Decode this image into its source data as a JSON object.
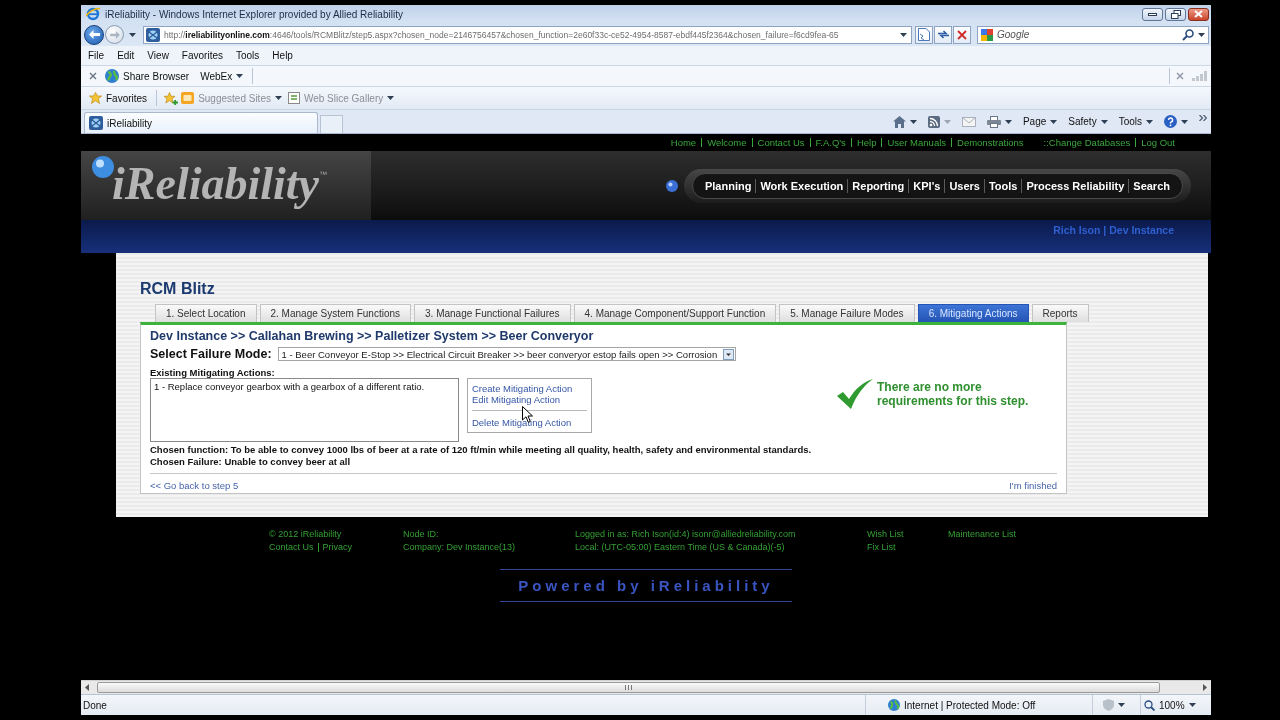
{
  "window": {
    "title": "iReliability - Windows Internet Explorer provided by Allied Reliability"
  },
  "address_bar": {
    "url": "http://**ireliabilityonline.com**:4646/tools/RCMBlitz/step5.aspx?chosen_node=2146756457&chosen_function=2e60f33c-ce52-4954-8587-ebdf445f2364&chosen_failure=f6cd9fea-65"
  },
  "search": {
    "placeholder": "Google"
  },
  "menu_bar": [
    "File",
    "Edit",
    "View",
    "Favorites",
    "Tools",
    "Help"
  ],
  "toolbar": [
    {
      "label": "Share Browser",
      "kind": "button"
    },
    {
      "label": "WebEx",
      "kind": "menu"
    }
  ],
  "favorites_bar": {
    "label": "Favorites",
    "items": [
      {
        "label": "Suggested Sites",
        "kind": "sites",
        "disabled": true
      },
      {
        "label": "Web Slice Gallery",
        "kind": "slice",
        "disabled": true
      }
    ]
  },
  "tabs": [
    {
      "label": "iReliability",
      "selected": true
    }
  ],
  "command_bar": [
    "Page",
    "Safety",
    "Tools"
  ],
  "page": {
    "top_links": [
      "Home",
      "Welcome",
      "Contact Us",
      "F.A.Q's",
      "Help",
      "User Manuals",
      "Demonstrations"
    ],
    "account_links": [
      "::Change Databases",
      "Log Out"
    ],
    "logo": {
      "name": "iReliability",
      "trademark": "™"
    },
    "nav": [
      "Planning",
      "Work Execution",
      "Reporting",
      "KPI's",
      "Users",
      "Tools",
      "Process Reliability",
      "Search"
    ],
    "user_line": "Rich Ison | Dev Instance",
    "blitz": {
      "title": "RCM Blitz",
      "steps": [
        {
          "label": "1. Select Location",
          "selected": false
        },
        {
          "label": "2. Manage System Functions",
          "selected": false
        },
        {
          "label": "3. Manage Functional Failures",
          "selected": false
        },
        {
          "label": "4. Manage Component/Support Function",
          "selected": false
        },
        {
          "label": "5. Manage Failure Modes",
          "selected": false
        },
        {
          "label": "6. Mitigating Actions",
          "selected": true
        },
        {
          "label": "Reports",
          "selected": false
        }
      ],
      "breadcrumb": "Dev Instance >> Callahan Brewing >> Palletizer System >> Beer Converyor",
      "failure_mode": {
        "label": "Select Failure Mode:",
        "value": "1 - Beer Conveyor E-Stop >> Electrical Circuit Breaker >> beer converyor estop fails open >> Corrosion"
      },
      "actions": {
        "label": "Existing Mitigating Actions:",
        "items": [
          "1 - Replace conveyor gearbox with a gearbox of a different ratio."
        ]
      },
      "action_link_groups": [
        [
          "Create Mitigating Action",
          "Edit Mitigating Action"
        ],
        [
          "Delete Mitigating Action"
        ]
      ],
      "message": "There are no more requirements for this step.",
      "chosen_function": "Chosen function: To be able to convey 1000 lbs of beer at a rate of 120 ft/min while meeting all quality, health, safety and environmental standards.",
      "chosen_failure": "Chosen Failure: Unable to convey beer at all",
      "back_link": "<< Go back to step 5",
      "finish_link": "I'm finished"
    },
    "footer": [
      {
        "lines": [
          [
            "© 2012 iReliability"
          ],
          [
            "Contact Us",
            "Privacy"
          ]
        ]
      },
      {
        "lines": [
          [
            "Node ID:"
          ],
          [
            "Company: Dev Instance(13)"
          ]
        ]
      },
      {
        "lines": [
          [
            "Logged in as: Rich Ison(id:4) isonr@alliedreliability.com"
          ],
          [
            "Local: (UTC-05:00) Eastern Time (US & Canada)(-5)"
          ]
        ]
      },
      {
        "lines": [
          [
            "Wish List"
          ],
          [
            "Fix List"
          ]
        ]
      },
      {
        "lines": [
          [
            "Maintenance List"
          ]
        ]
      }
    ],
    "powered_by": "Powered by iReliability"
  },
  "status_bar": {
    "text": "Done",
    "zone": "Internet | Protected Mode: Off",
    "zoom": "100%"
  }
}
